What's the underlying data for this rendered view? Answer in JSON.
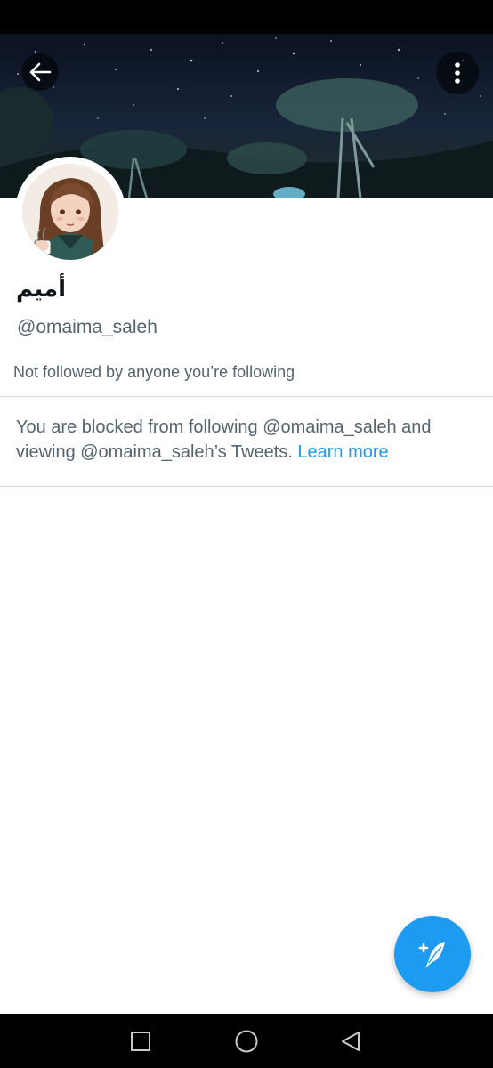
{
  "profile": {
    "display_name": "أميم",
    "handle": "@omaima_saleh",
    "followed_by_text": "Not followed by anyone you’re following"
  },
  "blocked_notice": {
    "text": "You are blocked from following @omaima_saleh and viewing @omaima_saleh’s Tweets.",
    "link_label": "Learn more"
  },
  "icons": {
    "back": "arrow-left-icon",
    "more": "more-vertical-icon",
    "compose": "compose-tweet-icon",
    "nav_recents": "square-icon",
    "nav_home": "circle-icon",
    "nav_back": "triangle-back-icon"
  },
  "colors": {
    "accent": "#1d9bf0",
    "secondary_text": "#536471",
    "primary_text": "#0f1419",
    "divider": "#d7dde2"
  }
}
